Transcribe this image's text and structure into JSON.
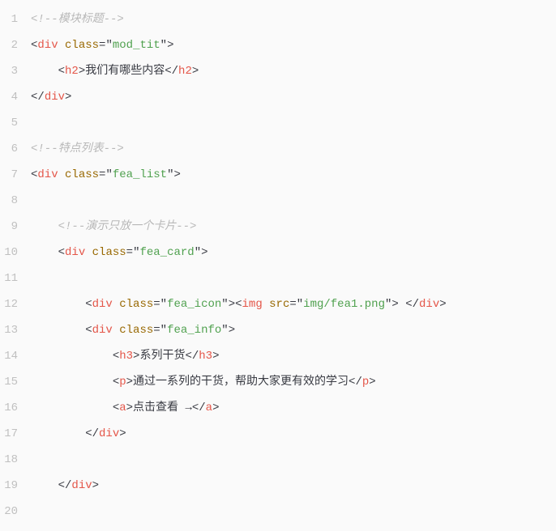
{
  "lines": [
    {
      "num": "1",
      "indent": 0,
      "tokens": [
        {
          "cls": "comment",
          "t": "<!--模块标题-->"
        }
      ]
    },
    {
      "num": "2",
      "indent": 0,
      "tokens": [
        {
          "cls": "punct",
          "t": "<"
        },
        {
          "cls": "tag",
          "t": "div"
        },
        {
          "cls": "text",
          "t": " "
        },
        {
          "cls": "attr-name",
          "t": "class"
        },
        {
          "cls": "punct",
          "t": "="
        },
        {
          "cls": "punct",
          "t": "\""
        },
        {
          "cls": "attr-value",
          "t": "mod_tit"
        },
        {
          "cls": "punct",
          "t": "\""
        },
        {
          "cls": "punct",
          "t": ">"
        }
      ]
    },
    {
      "num": "3",
      "indent": 1,
      "tokens": [
        {
          "cls": "punct",
          "t": "<"
        },
        {
          "cls": "tag",
          "t": "h2"
        },
        {
          "cls": "punct",
          "t": ">"
        },
        {
          "cls": "text",
          "t": "我们有哪些内容"
        },
        {
          "cls": "punct",
          "t": "</"
        },
        {
          "cls": "tag",
          "t": "h2"
        },
        {
          "cls": "punct",
          "t": ">"
        }
      ]
    },
    {
      "num": "4",
      "indent": 0,
      "tokens": [
        {
          "cls": "punct",
          "t": "</"
        },
        {
          "cls": "tag",
          "t": "div"
        },
        {
          "cls": "punct",
          "t": ">"
        }
      ]
    },
    {
      "num": "5",
      "indent": 0,
      "tokens": []
    },
    {
      "num": "6",
      "indent": 0,
      "tokens": [
        {
          "cls": "comment",
          "t": "<!--特点列表-->"
        }
      ]
    },
    {
      "num": "7",
      "indent": 0,
      "tokens": [
        {
          "cls": "punct",
          "t": "<"
        },
        {
          "cls": "tag",
          "t": "div"
        },
        {
          "cls": "text",
          "t": " "
        },
        {
          "cls": "attr-name",
          "t": "class"
        },
        {
          "cls": "punct",
          "t": "="
        },
        {
          "cls": "punct",
          "t": "\""
        },
        {
          "cls": "attr-value",
          "t": "fea_list"
        },
        {
          "cls": "punct",
          "t": "\""
        },
        {
          "cls": "punct",
          "t": ">"
        }
      ]
    },
    {
      "num": "8",
      "indent": 0,
      "tokens": []
    },
    {
      "num": "9",
      "indent": 1,
      "tokens": [
        {
          "cls": "comment",
          "t": "<!--演示只放一个卡片-->"
        }
      ]
    },
    {
      "num": "10",
      "indent": 1,
      "tokens": [
        {
          "cls": "punct",
          "t": "<"
        },
        {
          "cls": "tag",
          "t": "div"
        },
        {
          "cls": "text",
          "t": " "
        },
        {
          "cls": "attr-name",
          "t": "class"
        },
        {
          "cls": "punct",
          "t": "="
        },
        {
          "cls": "punct",
          "t": "\""
        },
        {
          "cls": "attr-value",
          "t": "fea_card"
        },
        {
          "cls": "punct",
          "t": "\""
        },
        {
          "cls": "punct",
          "t": ">"
        }
      ]
    },
    {
      "num": "11",
      "indent": 0,
      "tokens": []
    },
    {
      "num": "12",
      "indent": 2,
      "tokens": [
        {
          "cls": "punct",
          "t": "<"
        },
        {
          "cls": "tag",
          "t": "div"
        },
        {
          "cls": "text",
          "t": " "
        },
        {
          "cls": "attr-name",
          "t": "class"
        },
        {
          "cls": "punct",
          "t": "="
        },
        {
          "cls": "punct",
          "t": "\""
        },
        {
          "cls": "attr-value",
          "t": "fea_icon"
        },
        {
          "cls": "punct",
          "t": "\""
        },
        {
          "cls": "punct",
          "t": ">"
        },
        {
          "cls": "punct",
          "t": "<"
        },
        {
          "cls": "tag",
          "t": "img"
        },
        {
          "cls": "text",
          "t": " "
        },
        {
          "cls": "attr-name",
          "t": "src"
        },
        {
          "cls": "punct",
          "t": "="
        },
        {
          "cls": "punct",
          "t": "\""
        },
        {
          "cls": "attr-value",
          "t": "img/fea1.png"
        },
        {
          "cls": "punct",
          "t": "\""
        },
        {
          "cls": "punct",
          "t": ">"
        },
        {
          "cls": "text",
          "t": " "
        },
        {
          "cls": "punct",
          "t": "</"
        },
        {
          "cls": "tag",
          "t": "div"
        },
        {
          "cls": "punct",
          "t": ">"
        }
      ]
    },
    {
      "num": "13",
      "indent": 2,
      "tokens": [
        {
          "cls": "punct",
          "t": "<"
        },
        {
          "cls": "tag",
          "t": "div"
        },
        {
          "cls": "text",
          "t": " "
        },
        {
          "cls": "attr-name",
          "t": "class"
        },
        {
          "cls": "punct",
          "t": "="
        },
        {
          "cls": "punct",
          "t": "\""
        },
        {
          "cls": "attr-value",
          "t": "fea_info"
        },
        {
          "cls": "punct",
          "t": "\""
        },
        {
          "cls": "punct",
          "t": ">"
        }
      ]
    },
    {
      "num": "14",
      "indent": 3,
      "tokens": [
        {
          "cls": "punct",
          "t": "<"
        },
        {
          "cls": "tag",
          "t": "h3"
        },
        {
          "cls": "punct",
          "t": ">"
        },
        {
          "cls": "text",
          "t": "系列干货"
        },
        {
          "cls": "punct",
          "t": "</"
        },
        {
          "cls": "tag",
          "t": "h3"
        },
        {
          "cls": "punct",
          "t": ">"
        }
      ]
    },
    {
      "num": "15",
      "indent": 3,
      "tokens": [
        {
          "cls": "punct",
          "t": "<"
        },
        {
          "cls": "tag",
          "t": "p"
        },
        {
          "cls": "punct",
          "t": ">"
        },
        {
          "cls": "text",
          "t": "通过一系列的干货，帮助大家更有效的学习"
        },
        {
          "cls": "punct",
          "t": "</"
        },
        {
          "cls": "tag",
          "t": "p"
        },
        {
          "cls": "punct",
          "t": ">"
        }
      ]
    },
    {
      "num": "16",
      "indent": 3,
      "tokens": [
        {
          "cls": "punct",
          "t": "<"
        },
        {
          "cls": "tag",
          "t": "a"
        },
        {
          "cls": "punct",
          "t": ">"
        },
        {
          "cls": "text",
          "t": "点击查看 →"
        },
        {
          "cls": "punct",
          "t": "</"
        },
        {
          "cls": "tag",
          "t": "a"
        },
        {
          "cls": "punct",
          "t": ">"
        }
      ]
    },
    {
      "num": "17",
      "indent": 2,
      "tokens": [
        {
          "cls": "punct",
          "t": "</"
        },
        {
          "cls": "tag",
          "t": "div"
        },
        {
          "cls": "punct",
          "t": ">"
        }
      ]
    },
    {
      "num": "18",
      "indent": 0,
      "tokens": []
    },
    {
      "num": "19",
      "indent": 1,
      "tokens": [
        {
          "cls": "punct",
          "t": "</"
        },
        {
          "cls": "tag",
          "t": "div"
        },
        {
          "cls": "punct",
          "t": ">"
        }
      ]
    },
    {
      "num": "20",
      "indent": 0,
      "tokens": []
    }
  ]
}
